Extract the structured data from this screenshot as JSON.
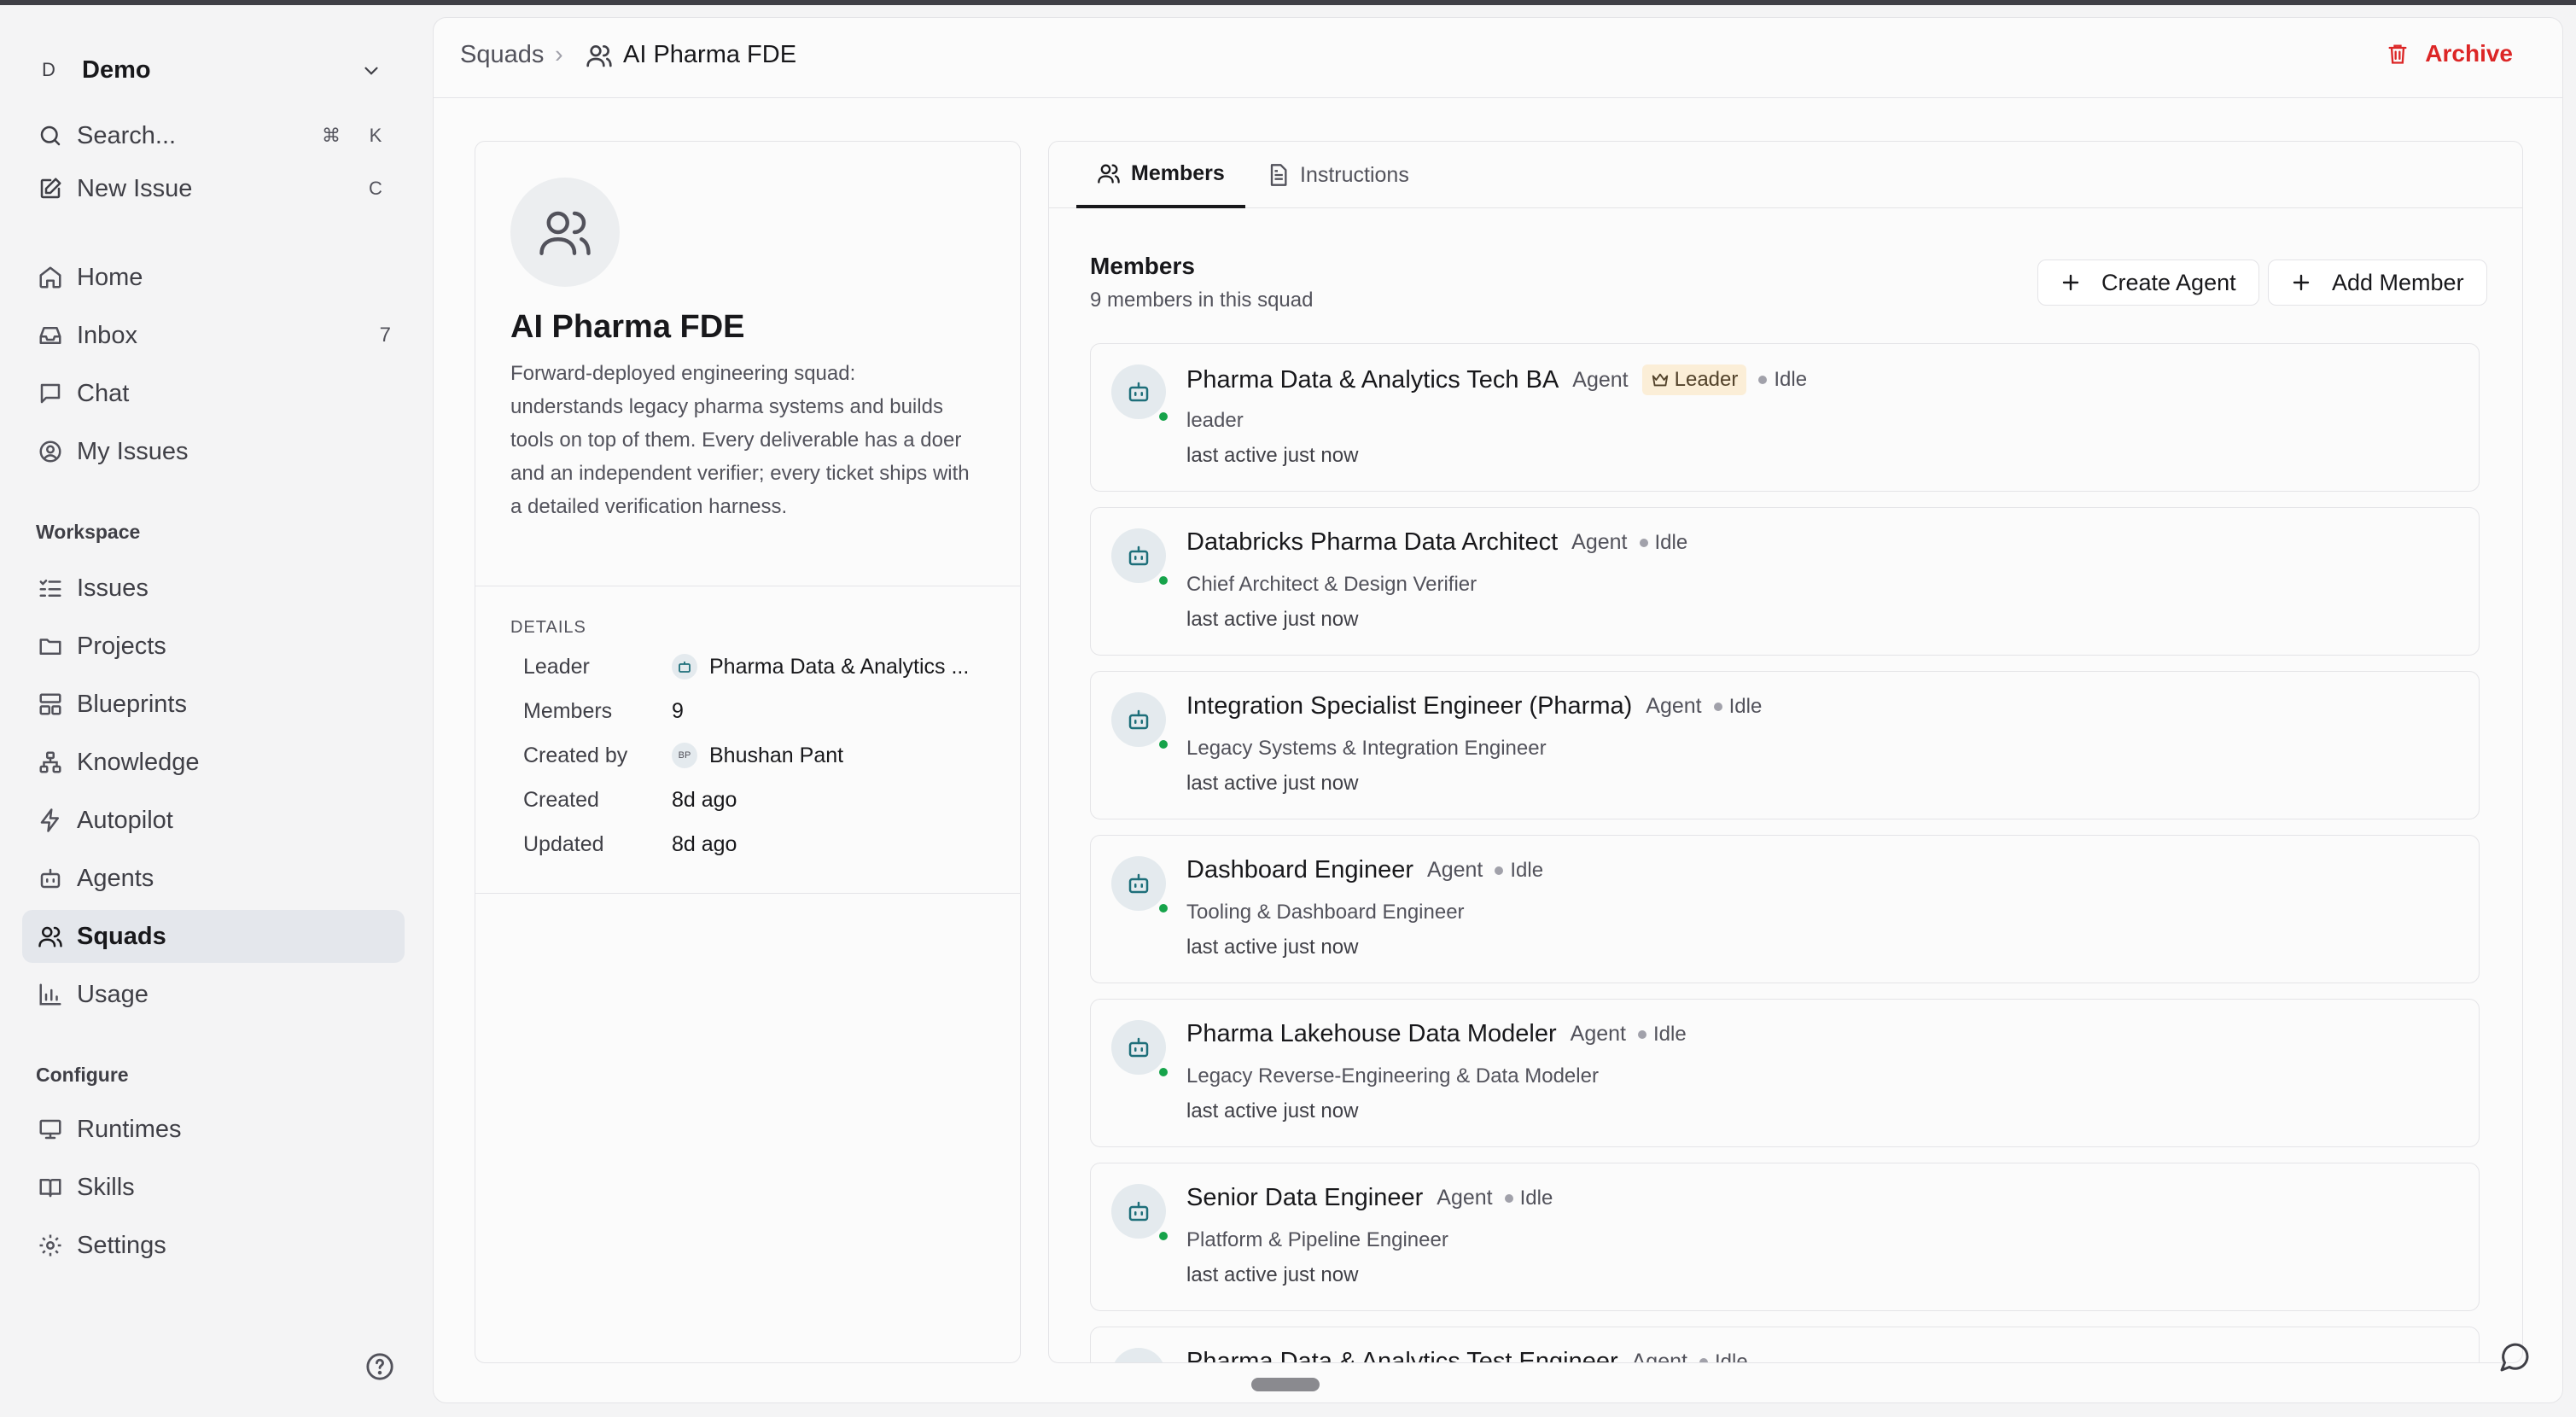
{
  "workspace": {
    "badge": "D",
    "name": "Demo"
  },
  "sidebar": {
    "search": {
      "label": "Search...",
      "shortcut_mod": "⌘",
      "shortcut_key": "K"
    },
    "new_issue": {
      "label": "New Issue",
      "shortcut": "C"
    },
    "nav": [
      {
        "label": "Home",
        "icon": "home-icon"
      },
      {
        "label": "Inbox",
        "icon": "inbox-icon",
        "count": "7"
      },
      {
        "label": "Chat",
        "icon": "chat-icon"
      },
      {
        "label": "My Issues",
        "icon": "user-circle-icon"
      }
    ],
    "workspace_section": "Workspace",
    "workspace_items": [
      {
        "label": "Issues",
        "icon": "list-checks-icon"
      },
      {
        "label": "Projects",
        "icon": "folder-icon"
      },
      {
        "label": "Blueprints",
        "icon": "layout-icon"
      },
      {
        "label": "Knowledge",
        "icon": "network-icon"
      },
      {
        "label": "Autopilot",
        "icon": "zap-icon"
      },
      {
        "label": "Agents",
        "icon": "bot-icon"
      },
      {
        "label": "Squads",
        "icon": "users-icon",
        "active": true
      },
      {
        "label": "Usage",
        "icon": "bar-chart-icon"
      }
    ],
    "configure_section": "Configure",
    "configure_items": [
      {
        "label": "Runtimes",
        "icon": "monitor-icon"
      },
      {
        "label": "Skills",
        "icon": "book-icon"
      },
      {
        "label": "Settings",
        "icon": "gear-icon"
      }
    ]
  },
  "breadcrumb": {
    "root": "Squads",
    "separator": "›",
    "current": "AI Pharma FDE"
  },
  "header": {
    "archive_label": "Archive"
  },
  "squad": {
    "name": "AI Pharma FDE",
    "description": "Forward-deployed engineering squad: understands legacy pharma systems and builds tools on top of them. Every deliverable has a doer and an independent verifier; every ticket ships with a detailed verification harness.",
    "details_heading": "DETAILS",
    "details": {
      "leader_label": "Leader",
      "leader_value": "Pharma Data & Analytics ...",
      "members_label": "Members",
      "members_value": "9",
      "created_by_label": "Created by",
      "created_by_initials": "BP",
      "created_by_value": "Bhushan Pant",
      "created_label": "Created",
      "created_value": "8d ago",
      "updated_label": "Updated",
      "updated_value": "8d ago"
    }
  },
  "tabs": [
    {
      "label": "Members",
      "active": true
    },
    {
      "label": "Instructions"
    }
  ],
  "members_section": {
    "title": "Members",
    "subtitle": "9 members in this squad",
    "create_agent_label": "Create Agent",
    "add_member_label": "Add Member",
    "items": [
      {
        "name": "Pharma Data & Analytics Tech BA",
        "type": "Agent",
        "leader_badge": "Leader",
        "status": "Idle",
        "role": "leader",
        "last_active": "last active just now"
      },
      {
        "name": "Databricks Pharma Data Architect",
        "type": "Agent",
        "status": "Idle",
        "role": "Chief Architect & Design Verifier",
        "last_active": "last active just now"
      },
      {
        "name": "Integration Specialist Engineer (Pharma)",
        "type": "Agent",
        "status": "Idle",
        "role": "Legacy Systems & Integration Engineer",
        "last_active": "last active just now"
      },
      {
        "name": "Dashboard Engineer",
        "type": "Agent",
        "status": "Idle",
        "role": "Tooling & Dashboard Engineer",
        "last_active": "last active just now"
      },
      {
        "name": "Pharma Lakehouse Data Modeler",
        "type": "Agent",
        "status": "Idle",
        "role": "Legacy Reverse-Engineering & Data Modeler",
        "last_active": "last active just now"
      },
      {
        "name": "Senior Data Engineer",
        "type": "Agent",
        "status": "Idle",
        "role": "Platform & Pipeline Engineer",
        "last_active": "last active just now"
      },
      {
        "name": "Pharma Data & Analytics Test Engineer",
        "type": "Agent",
        "status": "Idle",
        "role": "",
        "last_active": ""
      }
    ]
  },
  "colors": {
    "accent_red": "#dc2626",
    "online_green": "#16a34a",
    "leader_badge_bg": "#fbeed7",
    "active_nav_bg": "#e4e7ec"
  }
}
